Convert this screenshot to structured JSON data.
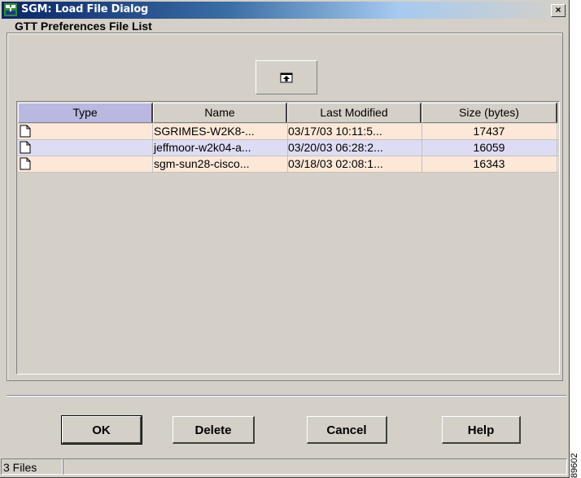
{
  "window": {
    "title": "SGM: Load File Dialog",
    "close_glyph": "×"
  },
  "group": {
    "label": "GTT Preferences File List"
  },
  "toolbar": {
    "upload_icon": "upload-icon"
  },
  "table": {
    "columns": [
      "Type",
      "Name",
      "Last Modified",
      "Size (bytes)"
    ],
    "sorted_column": "Type",
    "rows": [
      {
        "type_icon": "file-icon",
        "name": "SGRIMES-W2K8-...",
        "modified": "03/17/03  10:11:5...",
        "size": "17437"
      },
      {
        "type_icon": "file-icon",
        "name": "jeffmoor-w2k04-a...",
        "modified": "03/20/03  06:28:2...",
        "size": "16059"
      },
      {
        "type_icon": "file-icon",
        "name": "sgm-sun28-cisco...",
        "modified": "03/18/03  02:08:1...",
        "size": "16343"
      }
    ],
    "row_colors": [
      "#fde8d8",
      "#dcdcf4",
      "#fde8d8"
    ]
  },
  "buttons": {
    "ok": "OK",
    "delete": "Delete",
    "cancel": "Cancel",
    "help": "Help"
  },
  "status": {
    "count": "3 Files",
    "detail": ""
  },
  "figure_id": "89602"
}
